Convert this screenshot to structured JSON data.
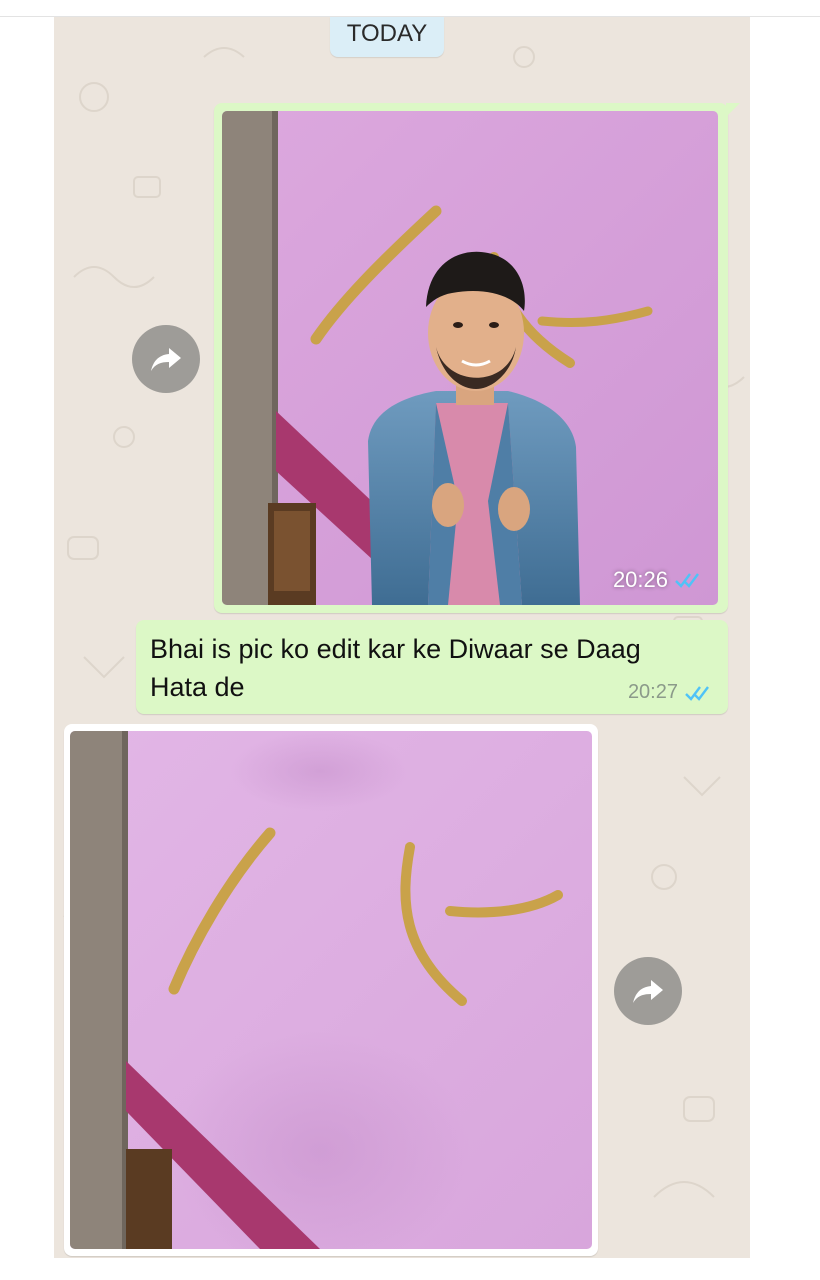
{
  "chat": {
    "date_label": "TODAY",
    "messages": [
      {
        "type": "image",
        "direction": "outgoing",
        "time": "20:26",
        "status": "read"
      },
      {
        "type": "text",
        "direction": "outgoing",
        "text": "Bhai is pic ko edit kar ke Diwaar se Daag Hata de",
        "time": "20:27",
        "status": "read"
      },
      {
        "type": "image",
        "direction": "incoming"
      }
    ]
  },
  "icons": {
    "forward": "forward-arrow-icon",
    "read_receipt": "double-check-icon"
  },
  "colors": {
    "chat_background": "#ece5dd",
    "outgoing_bubble": "#dcf8c6",
    "incoming_bubble": "#ffffff",
    "date_chip": "#dbeef7",
    "read_tick": "#4fc3f7",
    "forward_button": "#9e9c98"
  }
}
